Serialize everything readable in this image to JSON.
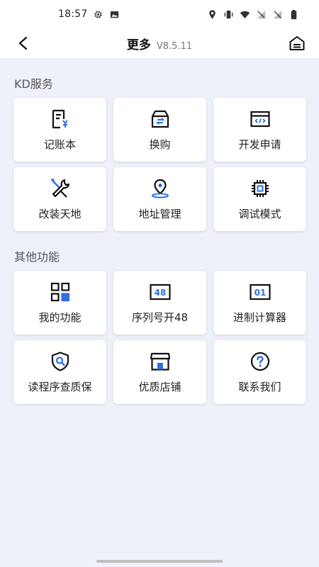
{
  "status_bar": {
    "time": "18:57",
    "left_icons": [
      "gear-icon",
      "image-icon"
    ],
    "right_icons": [
      "location-icon",
      "vibrate-icon",
      "wifi-icon",
      "no-sim-icon",
      "no-sim-icon",
      "battery-icon"
    ]
  },
  "header": {
    "title": "更多",
    "version": "V8.5.11"
  },
  "sections": [
    {
      "title": "KD服务",
      "items": [
        {
          "label": "记账本",
          "icon": "ledger-icon"
        },
        {
          "label": "换购",
          "icon": "exchange-box-icon"
        },
        {
          "label": "开发申请",
          "icon": "code-window-icon"
        },
        {
          "label": "改装天地",
          "icon": "tools-icon"
        },
        {
          "label": "地址管理",
          "icon": "location-pin-icon"
        },
        {
          "label": "调试模式",
          "icon": "chip-icon"
        }
      ]
    },
    {
      "title": "其他功能",
      "items": [
        {
          "label": "我的功能",
          "icon": "grid-apps-icon"
        },
        {
          "label": "序列号开48",
          "icon": "serial-48-icon",
          "icon_text": "48"
        },
        {
          "label": "进制计算器",
          "icon": "base-calculator-icon",
          "icon_text": "01"
        },
        {
          "label": "读程序查质保",
          "icon": "shield-search-icon"
        },
        {
          "label": "优质店铺",
          "icon": "store-icon"
        },
        {
          "label": "联系我们",
          "icon": "help-question-icon"
        }
      ]
    }
  ],
  "colors": {
    "accent": "#2f6fe0",
    "icon_dark": "#111111",
    "background": "#eef1fa"
  }
}
